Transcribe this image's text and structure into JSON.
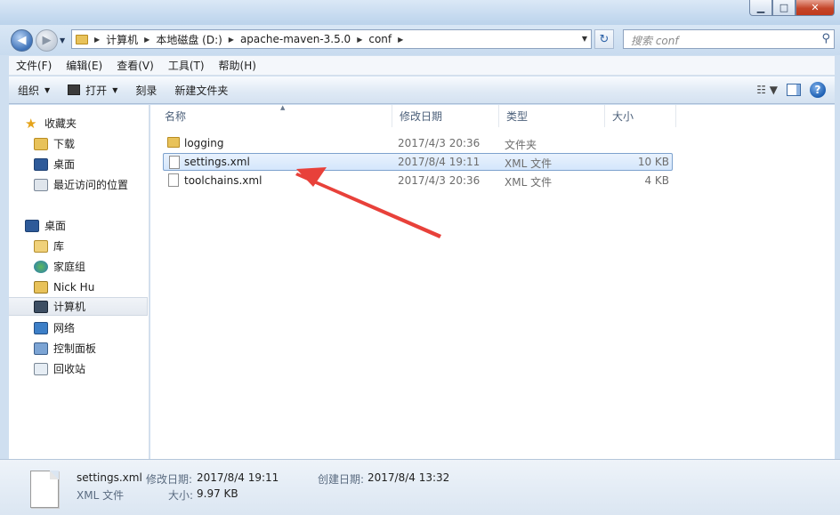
{
  "window": {
    "min_label": "▁",
    "max_label": "□",
    "close_label": "✕"
  },
  "address": {
    "crumbs": [
      "计算机",
      "本地磁盘 (D:)",
      "apache-maven-3.5.0",
      "conf"
    ],
    "search_placeholder": "搜索 conf"
  },
  "menu": [
    "文件(F)",
    "编辑(E)",
    "查看(V)",
    "工具(T)",
    "帮助(H)"
  ],
  "toolbar": {
    "organize": "组织",
    "open": "打开",
    "burn": "刻录",
    "new_folder": "新建文件夹"
  },
  "nav": {
    "favorites": "收藏夹",
    "downloads": "下载",
    "desktop_fav": "桌面",
    "recent": "最近访问的位置",
    "desktop": "桌面",
    "libraries": "库",
    "homegroup": "家庭组",
    "user": "Nick Hu",
    "computer": "计算机",
    "network": "网络",
    "control_panel": "控制面板",
    "recycle_bin": "回收站"
  },
  "columns": {
    "name": "名称",
    "date": "修改日期",
    "type": "类型",
    "size": "大小"
  },
  "files": [
    {
      "name": "logging",
      "date": "2017/4/3 20:36",
      "type": "文件夹",
      "size": ""
    },
    {
      "name": "settings.xml",
      "date": "2017/8/4 19:11",
      "type": "XML 文件",
      "size": "10 KB"
    },
    {
      "name": "toolchains.xml",
      "date": "2017/4/3 20:36",
      "type": "XML 文件",
      "size": "4 KB"
    }
  ],
  "details": {
    "filename": "settings.xml",
    "filetype": "XML 文件",
    "modified_label": "修改日期:",
    "modified_value": "2017/8/4 19:11",
    "size_label": "大小:",
    "size_value": "9.97 KB",
    "created_label": "创建日期:",
    "created_value": "2017/8/4 13:32"
  },
  "colors": {
    "annotation_arrow": "#e8413a",
    "selection": "#d4e6fc"
  }
}
